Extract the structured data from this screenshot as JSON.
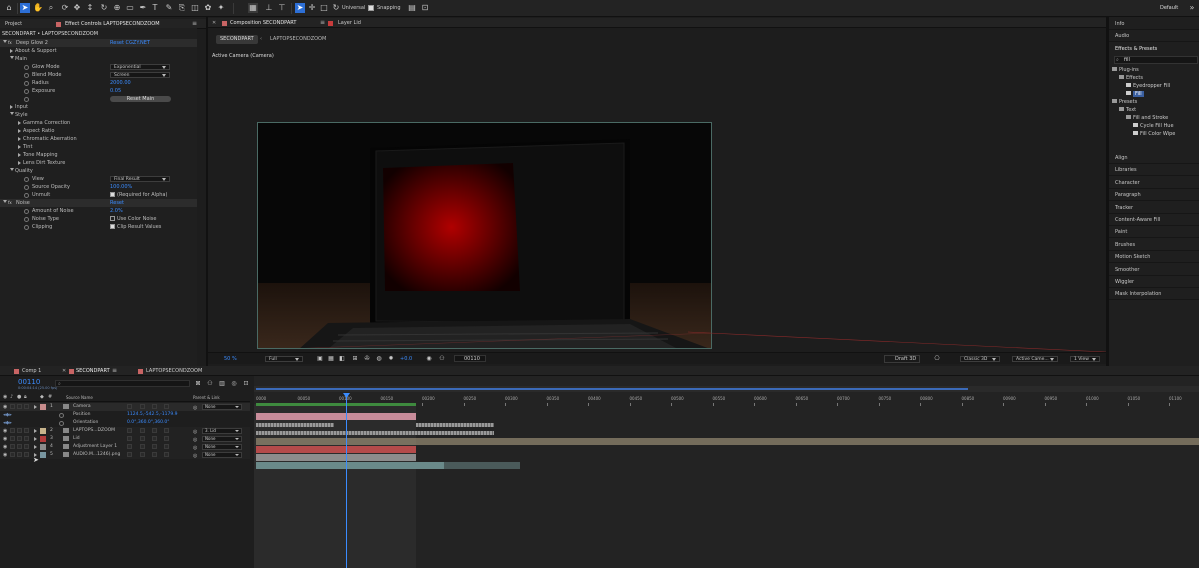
{
  "toolbar": {
    "universal_label": "Universal",
    "snapping_label": "Snapping",
    "workspace_label": "Default"
  },
  "left_panel": {
    "tab_project": "Project",
    "tab_effect_controls": "Effect Controls LAPTOPSECONDZOOM",
    "breadcrumb": "SECONDPART • LAPTOPSECONDZOOM",
    "rows": [
      {
        "label": "Deep Glow 2",
        "value": "Reset   CGZY.NET",
        "type": "fx"
      },
      {
        "label": "About & Support",
        "type": "group"
      },
      {
        "label": "Main",
        "type": "open"
      },
      {
        "label": "Glow Mode",
        "value": "Exponential",
        "type": "dd"
      },
      {
        "label": "Blend Mode",
        "value": "Screen",
        "type": "dd"
      },
      {
        "label": "Radius",
        "value": "2000.00",
        "type": "num"
      },
      {
        "label": "Exposure",
        "value": "0.05",
        "type": "num"
      },
      {
        "label": "",
        "value": "Reset Main",
        "type": "btn"
      },
      {
        "label": "Input",
        "type": "group"
      },
      {
        "label": "Style",
        "type": "open"
      },
      {
        "label": "Gamma Correction",
        "type": "sub"
      },
      {
        "label": "Aspect Ratio",
        "type": "sub"
      },
      {
        "label": "Chromatic Aberration",
        "type": "sub"
      },
      {
        "label": "Tint",
        "type": "sub"
      },
      {
        "label": "Tone Mapping",
        "type": "sub"
      },
      {
        "label": "Lens Dirt Texture",
        "type": "sub"
      },
      {
        "label": "Quality",
        "type": "open"
      },
      {
        "label": "View",
        "value": "Final Result",
        "type": "dd"
      },
      {
        "label": "Source Opacity",
        "value": "100.00%",
        "type": "num"
      },
      {
        "label": "Unmult",
        "value": "(Required for Alpha)",
        "type": "chk"
      },
      {
        "label": "Noise",
        "value": "Reset",
        "type": "fx"
      },
      {
        "label": "Amount of Noise",
        "value": "2.0%",
        "type": "num"
      },
      {
        "label": "Noise Type",
        "value": "Use Color Noise",
        "type": "chk0"
      },
      {
        "label": "Clipping",
        "value": "Clip Result Values",
        "type": "chk"
      }
    ]
  },
  "composition": {
    "tab_label": "Composition SECONDPART",
    "layer_tab": "Layer Lid",
    "subtab_active": "SECONDPART",
    "subtab_other": "LAPTOPSECONDZOOM",
    "camera_label": "Active Camera (Camera)",
    "zoom": "50 %",
    "resolution": "Full",
    "exposure": "+0.0",
    "timecode": "00110",
    "renderer_label": "Draft 3D",
    "renderer": "Classic 3D",
    "camera_select": "Active Came...",
    "views": "1 View"
  },
  "right_panel": {
    "items_top": [
      "Info",
      "Audio"
    ],
    "effects_presets_title": "Effects & Presets",
    "search_value": "fill",
    "tree": [
      {
        "label": "Plug-ins",
        "depth": 0
      },
      {
        "label": "Effects",
        "depth": 1
      },
      {
        "label": "Eyedropper Fill",
        "depth": 2
      },
      {
        "label": "Fill",
        "depth": 2,
        "selected": true
      },
      {
        "label": "Presets",
        "depth": 0
      },
      {
        "label": "Text",
        "depth": 1
      },
      {
        "label": "Fill and Stroke",
        "depth": 2
      },
      {
        "label": "Cycle Fill Hue",
        "depth": 3
      },
      {
        "label": "Fill Color Wipe",
        "depth": 3
      }
    ],
    "items_bottom": [
      "Align",
      "Libraries",
      "Character",
      "Paragraph",
      "Tracker",
      "Content-Aware Fill",
      "Paint",
      "Brushes",
      "Motion Sketch",
      "Smoother",
      "Wiggler",
      "Mask Interpolation"
    ]
  },
  "timeline": {
    "tabs": [
      "Comp 1",
      "SECONDPART",
      "LAPTOPSECONDZOOM"
    ],
    "timecode": "00110",
    "timecode_sub": "0:00:04:14 (25.00 fps)",
    "col_source": "Source Name",
    "col_parent": "Parent & Link",
    "ruler": [
      "0000",
      "00050",
      "00100",
      "00150",
      "00200",
      "00250",
      "00300",
      "00350",
      "00400",
      "00450",
      "00500",
      "00550",
      "00600",
      "00650",
      "00700",
      "00750",
      "00800",
      "00850",
      "00900",
      "00950",
      "01000",
      "01050",
      "01100"
    ],
    "layers": [
      {
        "num": "1",
        "name": "Camera",
        "parent": "None",
        "color": "#c88c8c"
      },
      {
        "num": "",
        "name": "Position",
        "parent": "",
        "value": "1124.5,-542.5,-1179.9"
      },
      {
        "num": "",
        "name": "Orientation",
        "parent": "",
        "value": "0.0°,360.0°,360.0°"
      },
      {
        "num": "2",
        "name": "LAPTOPS...DZOOM",
        "parent": "3. Lid",
        "color": "#c8b48c"
      },
      {
        "num": "3",
        "name": "Lid",
        "parent": "None",
        "color": "#b43c3c"
      },
      {
        "num": "4",
        "name": "Adjustment Layer 1",
        "parent": "None",
        "color": "#8c8c8c"
      },
      {
        "num": "5",
        "name": "AUDIO.M...1246).png",
        "parent": "None",
        "color": "#7896a0"
      }
    ]
  },
  "colors": {
    "accent": "#3b8cff",
    "screen_red": "#b00000"
  }
}
